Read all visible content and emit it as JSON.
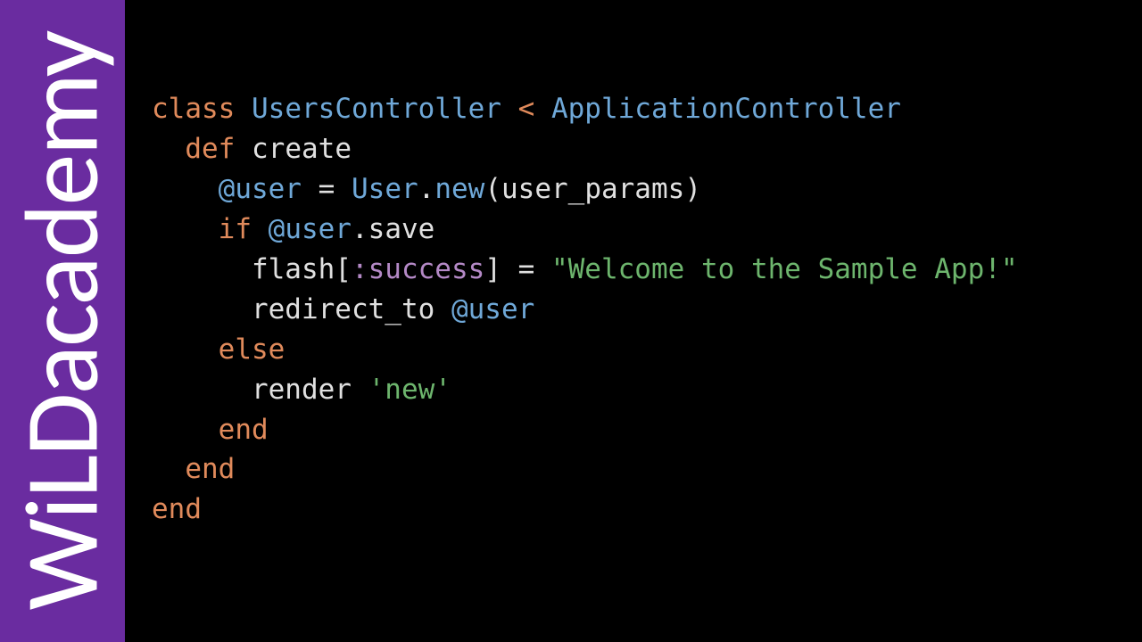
{
  "sidebar": {
    "brand": "WiLDacademy"
  },
  "code": {
    "kw_class": "class",
    "cls_users": "UsersController",
    "lt": "<",
    "cls_app": "ApplicationController",
    "kw_def": "def",
    "fn_name": "create",
    "ivar": "@user",
    "eq": "=",
    "cls_user": "User",
    "dot": ".",
    "new": "new",
    "lp": "(",
    "up": "user_params",
    "rp": ")",
    "kw_if": "if",
    "m_save": "save",
    "m_flash": "flash",
    "lb": "[",
    "sym_success": ":success",
    "rb": "]",
    "str_welcome": "\"Welcome to the Sample App!\"",
    "m_redirect": "redirect_to",
    "kw_else": "else",
    "m_render": "render",
    "str_new": "'new'",
    "kw_end": "end"
  }
}
